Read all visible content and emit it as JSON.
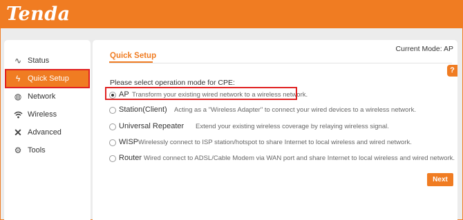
{
  "header": {
    "logo_text": "Tenda"
  },
  "sidebar": {
    "items": [
      {
        "label": "Status",
        "icon": "pulse-icon"
      },
      {
        "label": "Quick Setup",
        "icon": "lightning-icon",
        "active": true
      },
      {
        "label": "Network",
        "icon": "globe-icon"
      },
      {
        "label": "Wireless",
        "icon": "wifi-icon"
      },
      {
        "label": "Advanced",
        "icon": "tools-icon"
      },
      {
        "label": "Tools",
        "icon": "gears-icon"
      }
    ]
  },
  "main": {
    "current_mode": "Current Mode: AP",
    "title": "Quick Setup",
    "help_label": "?",
    "prompt": "Please select operation mode for CPE:",
    "modes": [
      {
        "name": "AP",
        "description": "Transform your existing wired network to a wireless network.",
        "selected": true
      },
      {
        "name": "Station(Client)",
        "description": "Acting as a \"Wireless Adapter\" to connect your wired devices to a wireless network.",
        "selected": false
      },
      {
        "name": "Universal Repeater",
        "description": "Extend your existing wireless coverage by relaying wireless signal.",
        "selected": false
      },
      {
        "name": "WISP",
        "description": "Wirelessly connect to ISP station/hotspot to share Internet to local wireless and wired network.",
        "selected": false
      },
      {
        "name": "Router",
        "description": "Wired connect to ADSL/Cable Modem via WAN port and share Internet to local wireless and wired network.",
        "selected": false
      }
    ],
    "next_label": "Next"
  },
  "colors": {
    "accent": "#f07c22",
    "highlight": "#e02020"
  }
}
